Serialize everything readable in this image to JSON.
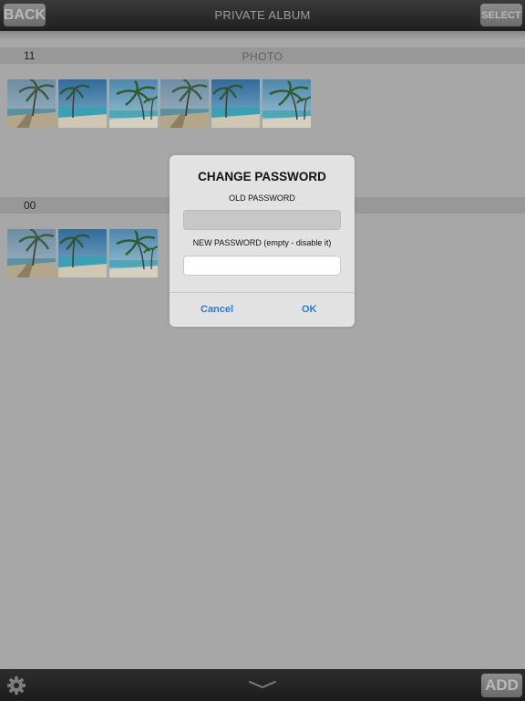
{
  "topbar": {
    "back_label": "BACK",
    "title": "PRIVATE ALBUM",
    "select_label": "SELECT"
  },
  "sections": [
    {
      "count": "11",
      "title": "PHOTO",
      "thumbnails": [
        "beach-1",
        "beach-2",
        "beach-3",
        "beach-1",
        "beach-2",
        "beach-3"
      ]
    },
    {
      "count": "00",
      "title": "",
      "thumbnails": [
        "beach-1",
        "beach-2",
        "beach-3"
      ]
    }
  ],
  "dialog": {
    "title": "CHANGE PASSWORD",
    "old_label": "OLD PASSWORD",
    "old_value": "",
    "new_label": "NEW PASSWORD (empty - disable it)",
    "new_value": "",
    "cancel_label": "Cancel",
    "ok_label": "OK"
  },
  "bottombar": {
    "settings_icon": "gear-icon",
    "collapse_icon": "chevron-down-icon",
    "add_label": "ADD"
  },
  "colors": {
    "link_blue": "#2b7bd1",
    "overlay_gray": "#a7a7a7"
  }
}
